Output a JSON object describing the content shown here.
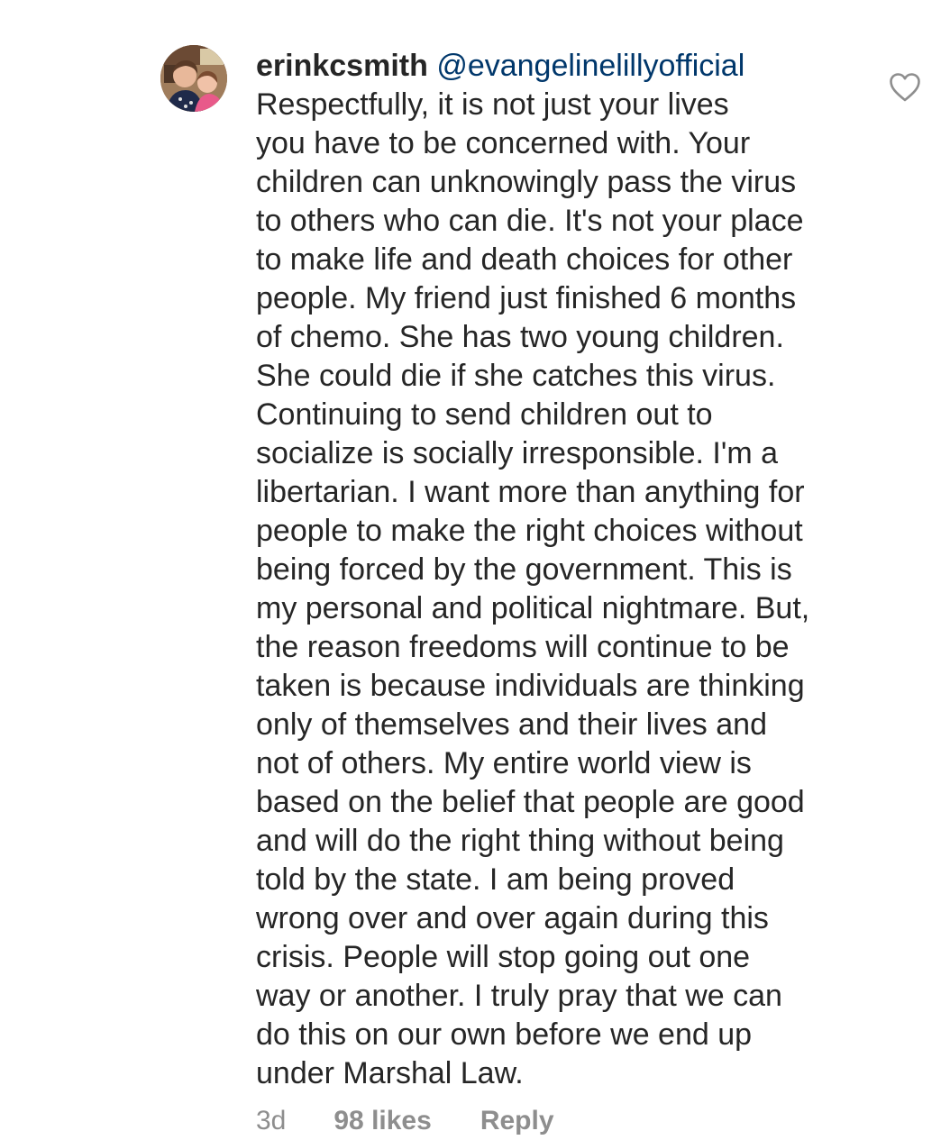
{
  "comment": {
    "username": "erinkcsmith",
    "mention": "@evangelinelillyofficial",
    "lines": [
      "Respectfully, it is not just your lives",
      "you have to be concerned with. Your",
      "children can unknowingly pass the virus",
      "to others who can die. It's not your place",
      "to make life and death choices for other",
      "people. My friend just finished 6 months",
      "of chemo. She has two young children.",
      "She could die if she catches this virus.",
      "Continuing to send children out to",
      "socialize is socially irresponsible. I'm a",
      "libertarian. I want more than anything for",
      "people to make the right choices without",
      "being forced by the government. This is",
      "my personal and political nightmare. But,",
      "the reason freedoms will continue to be",
      "taken is because individuals are thinking",
      "only of themselves and their lives and",
      "not of others. My entire world view is",
      "based on the belief that people are good",
      "and will do the right thing without being",
      "told by the state. I am being proved",
      "wrong over and over again during this",
      "crisis. People will stop going out one",
      "way or another. I truly pray that we can",
      "do this on our own before we end up",
      "under Marshal Law."
    ],
    "time": "3d",
    "likes": "98 likes",
    "reply_label": "Reply",
    "like_icon": "heart-outline-icon"
  },
  "colors": {
    "text": "#262626",
    "mention": "#00376b",
    "meta": "#8e8e8e",
    "icon": "#8e8e8e"
  }
}
